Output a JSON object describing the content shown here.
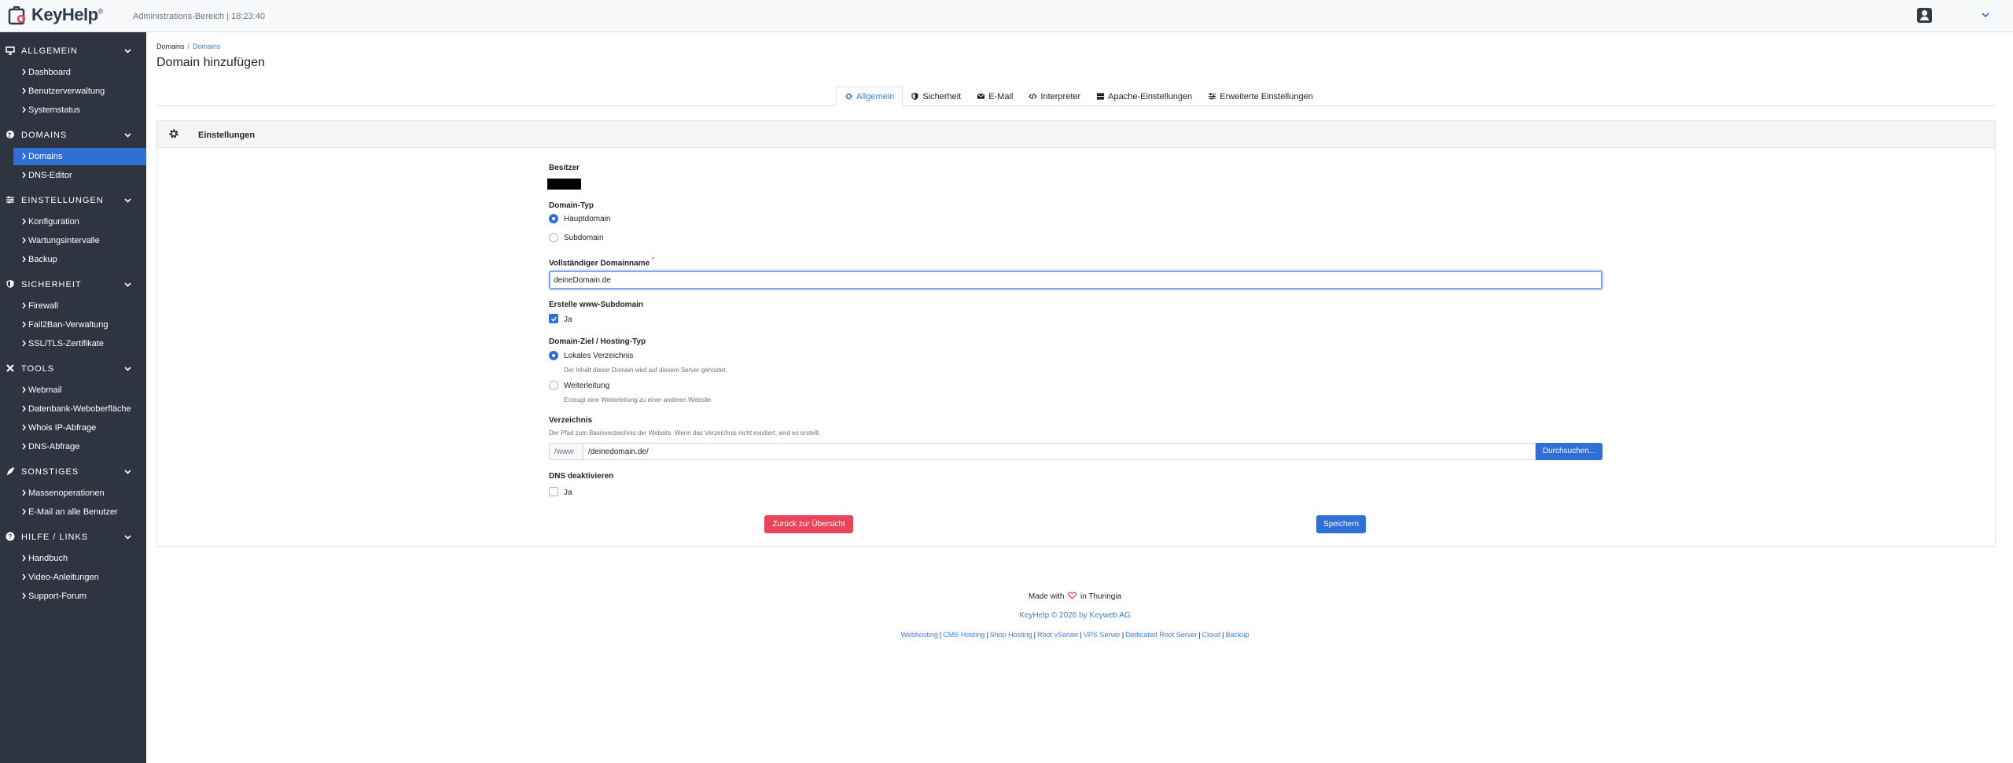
{
  "topbar": {
    "logo_text": "KeyHelp",
    "logo_reg": "®",
    "subtitle": "Administrations-Bereich | 18:23:40"
  },
  "sidebar": {
    "sections": [
      {
        "label": "ALLGEMEIN",
        "icon": "monitor-icon",
        "items": [
          "Dashboard",
          "Benutzerverwaltung",
          "Systemstatus"
        ]
      },
      {
        "label": "DOMAINS",
        "icon": "globe-icon",
        "items": [
          "Domains",
          "DNS-Editor"
        ]
      },
      {
        "label": "EINSTELLUNGEN",
        "icon": "sliders-icon",
        "items": [
          "Konfiguration",
          "Wartungsintervalle",
          "Backup"
        ]
      },
      {
        "label": "SICHERHEIT",
        "icon": "shield-icon",
        "items": [
          "Firewall",
          "Fail2Ban-Verwaltung",
          "SSL/TLS-Zertifikate"
        ]
      },
      {
        "label": "TOOLS",
        "icon": "tools-icon",
        "items": [
          "Webmail",
          "Datenbank-Weboberfläche",
          "Whois IP-Abfrage",
          "DNS-Abfrage"
        ]
      },
      {
        "label": "SONSTIGES",
        "icon": "feather-icon",
        "items": [
          "Massenoperationen",
          "E-Mail an alle Benutzer"
        ]
      },
      {
        "label": "HILFE / LINKS",
        "icon": "help-icon",
        "items": [
          "Handbuch",
          "Video-Anleitungen",
          "Support-Forum"
        ]
      }
    ],
    "active_item": "Domains"
  },
  "breadcrumb": {
    "root": "Domains",
    "separator": "/",
    "current": "Domains"
  },
  "page_title": "Domain hinzufügen",
  "tabs": [
    {
      "label": "Allgemein",
      "icon": "gear-icon",
      "active": true
    },
    {
      "label": "Sicherheit",
      "icon": "shield-icon",
      "active": false
    },
    {
      "label": "E-Mail",
      "icon": "envelope-icon",
      "active": false
    },
    {
      "label": "Interpreter",
      "icon": "code-icon",
      "active": false
    },
    {
      "label": "Apache-Einstellungen",
      "icon": "server-icon",
      "active": false
    },
    {
      "label": "Erweiterte Einstellungen",
      "icon": "sliders-icon",
      "active": false
    }
  ],
  "card": {
    "title": "Einstellungen"
  },
  "form": {
    "owner_label": "Besitzer",
    "domain_type_label": "Domain-Typ",
    "domain_type_options": [
      "Hauptdomain",
      "Subdomain"
    ],
    "domain_type_selected": "Hauptdomain",
    "fqdn_label": "Vollständiger Domainname",
    "fqdn_required": "*",
    "fqdn_value": "deineDomain.de",
    "www_label": "Erstelle www-Subdomain",
    "www_option": "Ja",
    "www_checked": true,
    "target_label": "Domain-Ziel / Hosting-Typ",
    "target_local": "Lokales Verzeichnis",
    "target_local_help": "Der Inhalt dieser Domain wird auf diesem Server gehostet.",
    "target_redirect": "Weiterleitung",
    "target_redirect_help": "Erzeugt eine Weiterleitung zu einer anderen Website.",
    "target_selected": "Lokales Verzeichnis",
    "dir_label": "Verzeichnis",
    "dir_help": "Der Pfad zum Basisverzeichnis der Website. Wenn das Verzeichnis nicht existiert, wird es erstellt.",
    "dir_prefix": "/www",
    "dir_value": "/deinedomain.de/",
    "browse_button": "Durchsuchen...",
    "dns_label": "DNS deaktivieren",
    "dns_option": "Ja",
    "dns_checked": false,
    "back_button": "Zurück zur Übersicht",
    "save_button": "Speichern"
  },
  "footer": {
    "made_with": "Made with",
    "in_place": "in Thuringia",
    "copyright": "KeyHelp © 2026 by Keyweb AG",
    "links": [
      "Webhosting",
      "CMS Hosting",
      "Shop Hosting",
      "Root vServer",
      "VPS Server",
      "Dedicated Root Server",
      "Cloud",
      "Backup"
    ],
    "link_separator": "|"
  },
  "colors": {
    "sidebar_bg": "#2e3440",
    "active_blue": "#2f6fd6",
    "danger": "#e8445a",
    "link": "#3c7ed8"
  }
}
